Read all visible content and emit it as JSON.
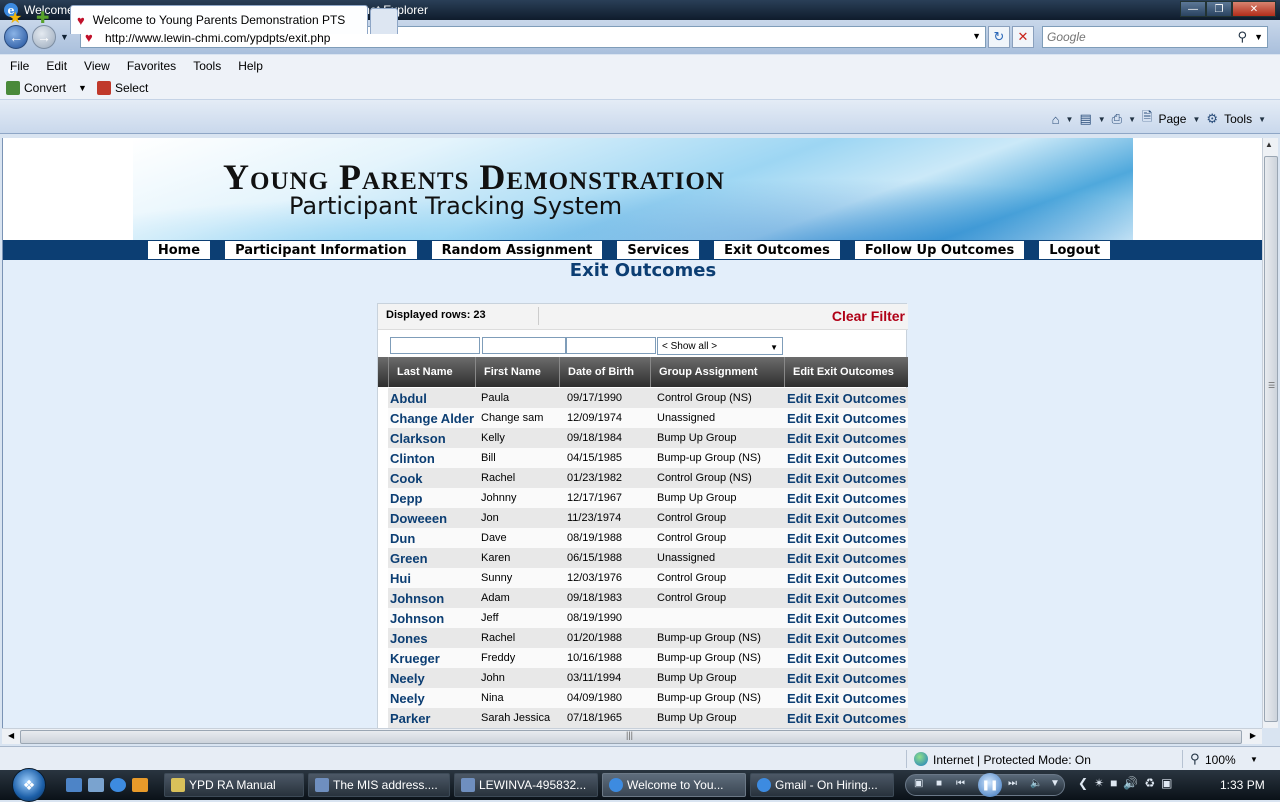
{
  "window": {
    "title": "Welcome to Young Parents Demonstration PTS - Windows Internet Explorer"
  },
  "address_bar": {
    "url": "http://www.lewin-chmi.com/ypdpts/exit.php"
  },
  "search": {
    "placeholder": "Google"
  },
  "menu": [
    "File",
    "Edit",
    "View",
    "Favorites",
    "Tools",
    "Help"
  ],
  "convert_bar": {
    "convert_label": "Convert",
    "select_label": "Select"
  },
  "tab": {
    "label": "Welcome to Young Parents Demonstration PTS"
  },
  "command_bar": {
    "page_label": "Page",
    "tools_label": "Tools"
  },
  "banner": {
    "title": "Young Parents Demonstration",
    "subtitle": "Participant Tracking System"
  },
  "nav": [
    "Home",
    "Participant Information",
    "Random Assignment",
    "Services",
    "Exit Outcomes",
    "Follow Up Outcomes",
    "Logout"
  ],
  "page": {
    "title": "Exit Outcomes"
  },
  "grid": {
    "displayed_rows": "Displayed rows: 23",
    "clear_filter": "Clear Filter",
    "group_filter": "< Show all >",
    "columns": [
      "Last Name",
      "First Name",
      "Date of Birth",
      "Group Assignment",
      "Edit Exit Outcomes"
    ],
    "link_text": "Edit Exit Outcomes",
    "rows": [
      {
        "last": "Abdul",
        "first": "Paula",
        "dob": "09/17/1990",
        "group": "Control Group (NS)"
      },
      {
        "last": "Change Alder",
        "first": "Change sam",
        "dob": "12/09/1974",
        "group": "Unassigned"
      },
      {
        "last": "Clarkson",
        "first": "Kelly",
        "dob": "09/18/1984",
        "group": "Bump Up Group"
      },
      {
        "last": "Clinton",
        "first": "Bill",
        "dob": "04/15/1985",
        "group": "Bump-up Group (NS)"
      },
      {
        "last": "Cook",
        "first": "Rachel",
        "dob": "01/23/1982",
        "group": "Control Group (NS)"
      },
      {
        "last": "Depp",
        "first": "Johnny",
        "dob": "12/17/1967",
        "group": "Bump Up Group"
      },
      {
        "last": "Doweeen",
        "first": "Jon",
        "dob": "11/23/1974",
        "group": "Control Group"
      },
      {
        "last": "Dun",
        "first": "Dave",
        "dob": "08/19/1988",
        "group": "Control Group"
      },
      {
        "last": "Green",
        "first": "Karen",
        "dob": "06/15/1988",
        "group": "Unassigned"
      },
      {
        "last": "Hui",
        "first": "Sunny",
        "dob": "12/03/1976",
        "group": "Control Group"
      },
      {
        "last": "Johnson",
        "first": "Adam",
        "dob": "09/18/1983",
        "group": "Control Group"
      },
      {
        "last": "Johnson",
        "first": "Jeff",
        "dob": "08/19/1990",
        "group": ""
      },
      {
        "last": "Jones",
        "first": "Rachel",
        "dob": "01/20/1988",
        "group": "Bump-up Group (NS)"
      },
      {
        "last": "Krueger",
        "first": "Freddy",
        "dob": "10/16/1988",
        "group": "Bump-up Group (NS)"
      },
      {
        "last": "Neely",
        "first": "John",
        "dob": "03/11/1994",
        "group": "Bump Up Group"
      },
      {
        "last": "Neely",
        "first": "Nina",
        "dob": "04/09/1980",
        "group": "Bump-up Group (NS)"
      },
      {
        "last": "Parker",
        "first": "Sarah Jessica",
        "dob": "07/18/1965",
        "group": "Bump Up Group"
      }
    ]
  },
  "status_bar": {
    "zone": "Internet | Protected Mode: On",
    "zoom": "100%"
  },
  "taskbar": {
    "tasks": [
      "YPD RA Manual",
      "The MIS address....",
      "LEWINVA-495832...",
      "Welcome to You...",
      "Gmail - On Hiring..."
    ],
    "clock": "1:33 PM"
  },
  "colors": {
    "brand_navy": "#0c3e73",
    "clear_filter_red": "#b00016"
  }
}
